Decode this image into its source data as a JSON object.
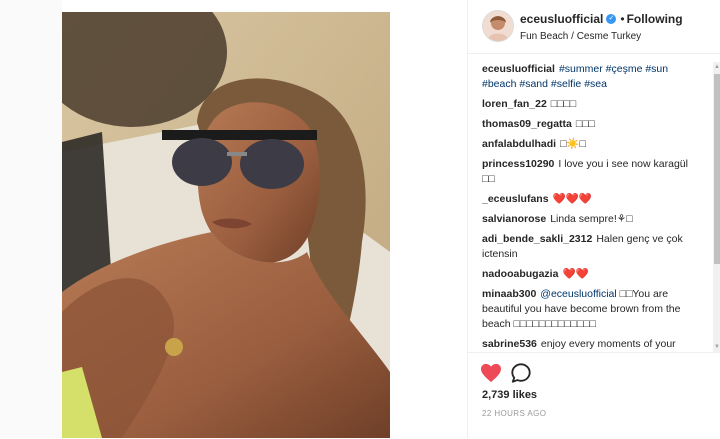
{
  "post": {
    "username": "eceusluofficial",
    "verified_icon": "verified-badge-icon",
    "separator": "•",
    "follow_status": "Following",
    "location": "Fun Beach / Cesme Turkey",
    "likes": "2,739 likes",
    "timestamp": "22 HOURS AGO"
  },
  "caption": {
    "user": "eceusluofficial",
    "tags": [
      "#summer",
      "#çeşme",
      "#sun",
      "#beach",
      "#sand",
      "#selfie",
      "#sea"
    ]
  },
  "comments": [
    {
      "user": "loren_fan_22",
      "text": "□□□□"
    },
    {
      "user": "thomas09_regatta",
      "text": "□□□"
    },
    {
      "user": "anfalabdulhadi",
      "text": "□☀️□"
    },
    {
      "user": "princess10290",
      "text": "I love you i see now karagül □□"
    },
    {
      "user": "_eceuslufans",
      "text": "❤️❤️❤️"
    },
    {
      "user": "salvianorose",
      "text": "Linda sempre!⚘□"
    },
    {
      "user": "adi_bende_sakli_2312",
      "text": "Halen genç ve çok ictensin"
    },
    {
      "user": "nadooabugazia",
      "text": "❤️❤️"
    },
    {
      "user": "minaab300",
      "mention": "@eceusluofficial",
      "text": "□□You are beautiful you have become brown from the beach □□□□□□□□□□□□□"
    },
    {
      "user": "sabrine536",
      "text": "enjoy every moments of your life□□□□□"
    }
  ],
  "icons": {
    "like": "heart-icon",
    "comment": "comment-bubble-icon"
  },
  "colors": {
    "heart": "#ed4956",
    "link": "#003569",
    "verified": "#3897f0"
  }
}
